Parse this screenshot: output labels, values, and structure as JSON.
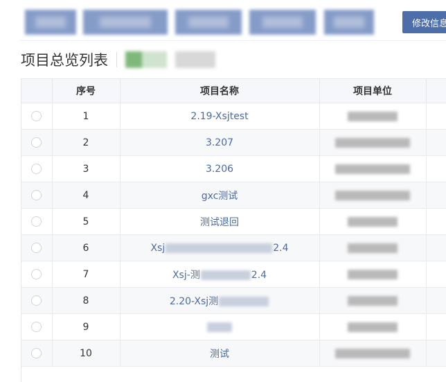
{
  "header": {
    "edit_button_label": "修改信息"
  },
  "page": {
    "title": "项目总览列表"
  },
  "table": {
    "columns": [
      "",
      "序号",
      "项目名称",
      "项目单位",
      ""
    ],
    "rows": [
      {
        "num": "1",
        "name": "2.19-Xsjtest",
        "name_suffix": ""
      },
      {
        "num": "2",
        "name": "3.207",
        "name_suffix": ""
      },
      {
        "num": "3",
        "name": "3.206",
        "name_suffix": ""
      },
      {
        "num": "4",
        "name": "gxc测试",
        "name_suffix": ""
      },
      {
        "num": "5",
        "name": "测试退回",
        "name_suffix": ""
      },
      {
        "num": "6",
        "name": "Xsj",
        "name_suffix": "2.4"
      },
      {
        "num": "7",
        "name": "Xsj-测",
        "name_suffix": "2.4"
      },
      {
        "num": "8",
        "name": "2.20-Xsj测",
        "name_suffix": ""
      },
      {
        "num": "9",
        "name": "",
        "name_suffix": ""
      },
      {
        "num": "10",
        "name": "测试",
        "name_suffix": ""
      }
    ]
  },
  "colors": {
    "accent": "#4e6ea9",
    "link": "#4a6aa5",
    "header_bg": "#f5f7fa"
  }
}
